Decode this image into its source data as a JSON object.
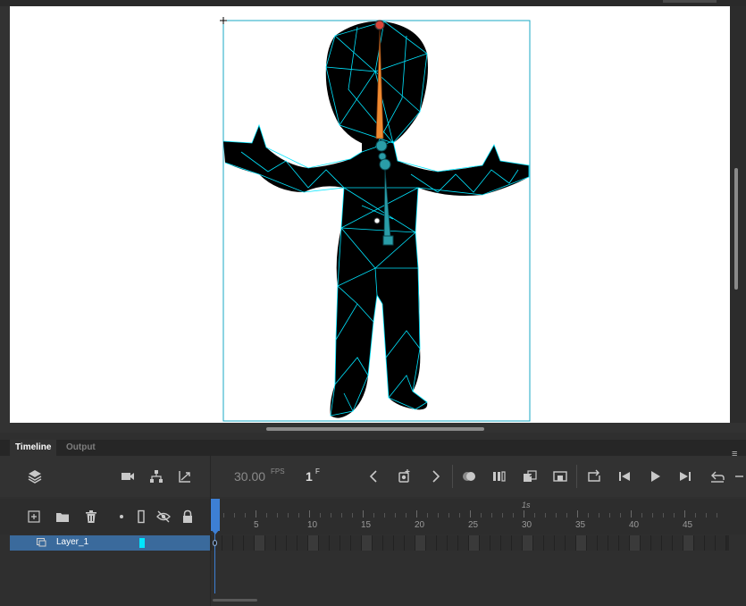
{
  "timeline_panel": {
    "tabs": [
      {
        "label": "Timeline",
        "active": true
      },
      {
        "label": "Output",
        "active": false
      }
    ],
    "fps_value": "30.00",
    "fps_unit": "FPS",
    "current_frame": "1",
    "frame_unit": "F",
    "ruler_labels": [
      "5",
      "10",
      "15",
      "20",
      "25",
      "30",
      "35",
      "40",
      "45"
    ],
    "time_marker": "1s",
    "layers": [
      {
        "name": "Layer_1",
        "selected": true,
        "color": "#00e5ff"
      }
    ]
  },
  "colors": {
    "accent": "#3d7fd4",
    "mesh": "#00e5ff",
    "bone": "#f08a30",
    "selection_row": "#3a6a9c"
  },
  "icons": {
    "toolbar_left": [
      "layers-icon",
      "camera-icon",
      "hierarchy-icon",
      "graph-icon"
    ],
    "toolbar_right": [
      "chevron-left-icon",
      "add-keyframe-icon",
      "chevron-right-icon",
      "onion-skin-icon",
      "edit-multiple-frames-icon",
      "insert-frame-icon",
      "remove-frame-icon",
      "loop-icon",
      "step-back-icon",
      "play-icon",
      "step-forward-icon",
      "undo-icon"
    ],
    "layer_tools": [
      "new-layer-icon",
      "new-folder-icon",
      "delete-icon",
      "dot-icon",
      "outline-icon",
      "eye-hidden-icon",
      "lock-icon"
    ]
  }
}
